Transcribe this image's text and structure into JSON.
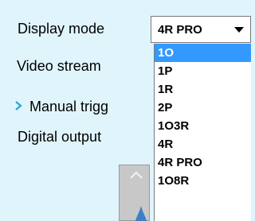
{
  "fields": {
    "display_mode_label": "Display mode",
    "video_stream_label": "Video stream",
    "manual_trigger_label": "Manual trigg",
    "digital_output_label": "Digital output"
  },
  "display_mode": {
    "selected": "4R PRO",
    "options": [
      "1O",
      "1P",
      "1R",
      "2P",
      "1O3R",
      "4R",
      "4R PRO",
      "1O8R"
    ],
    "highlighted": "1O"
  },
  "colors": {
    "background": "#e0f4fc",
    "highlight": "#3399ff",
    "expand_icon": "#29a3d6"
  },
  "icons": {
    "expand": "chevron-right-icon",
    "dropdown": "caret-down-icon",
    "slider_up": "chevron-up-icon"
  }
}
